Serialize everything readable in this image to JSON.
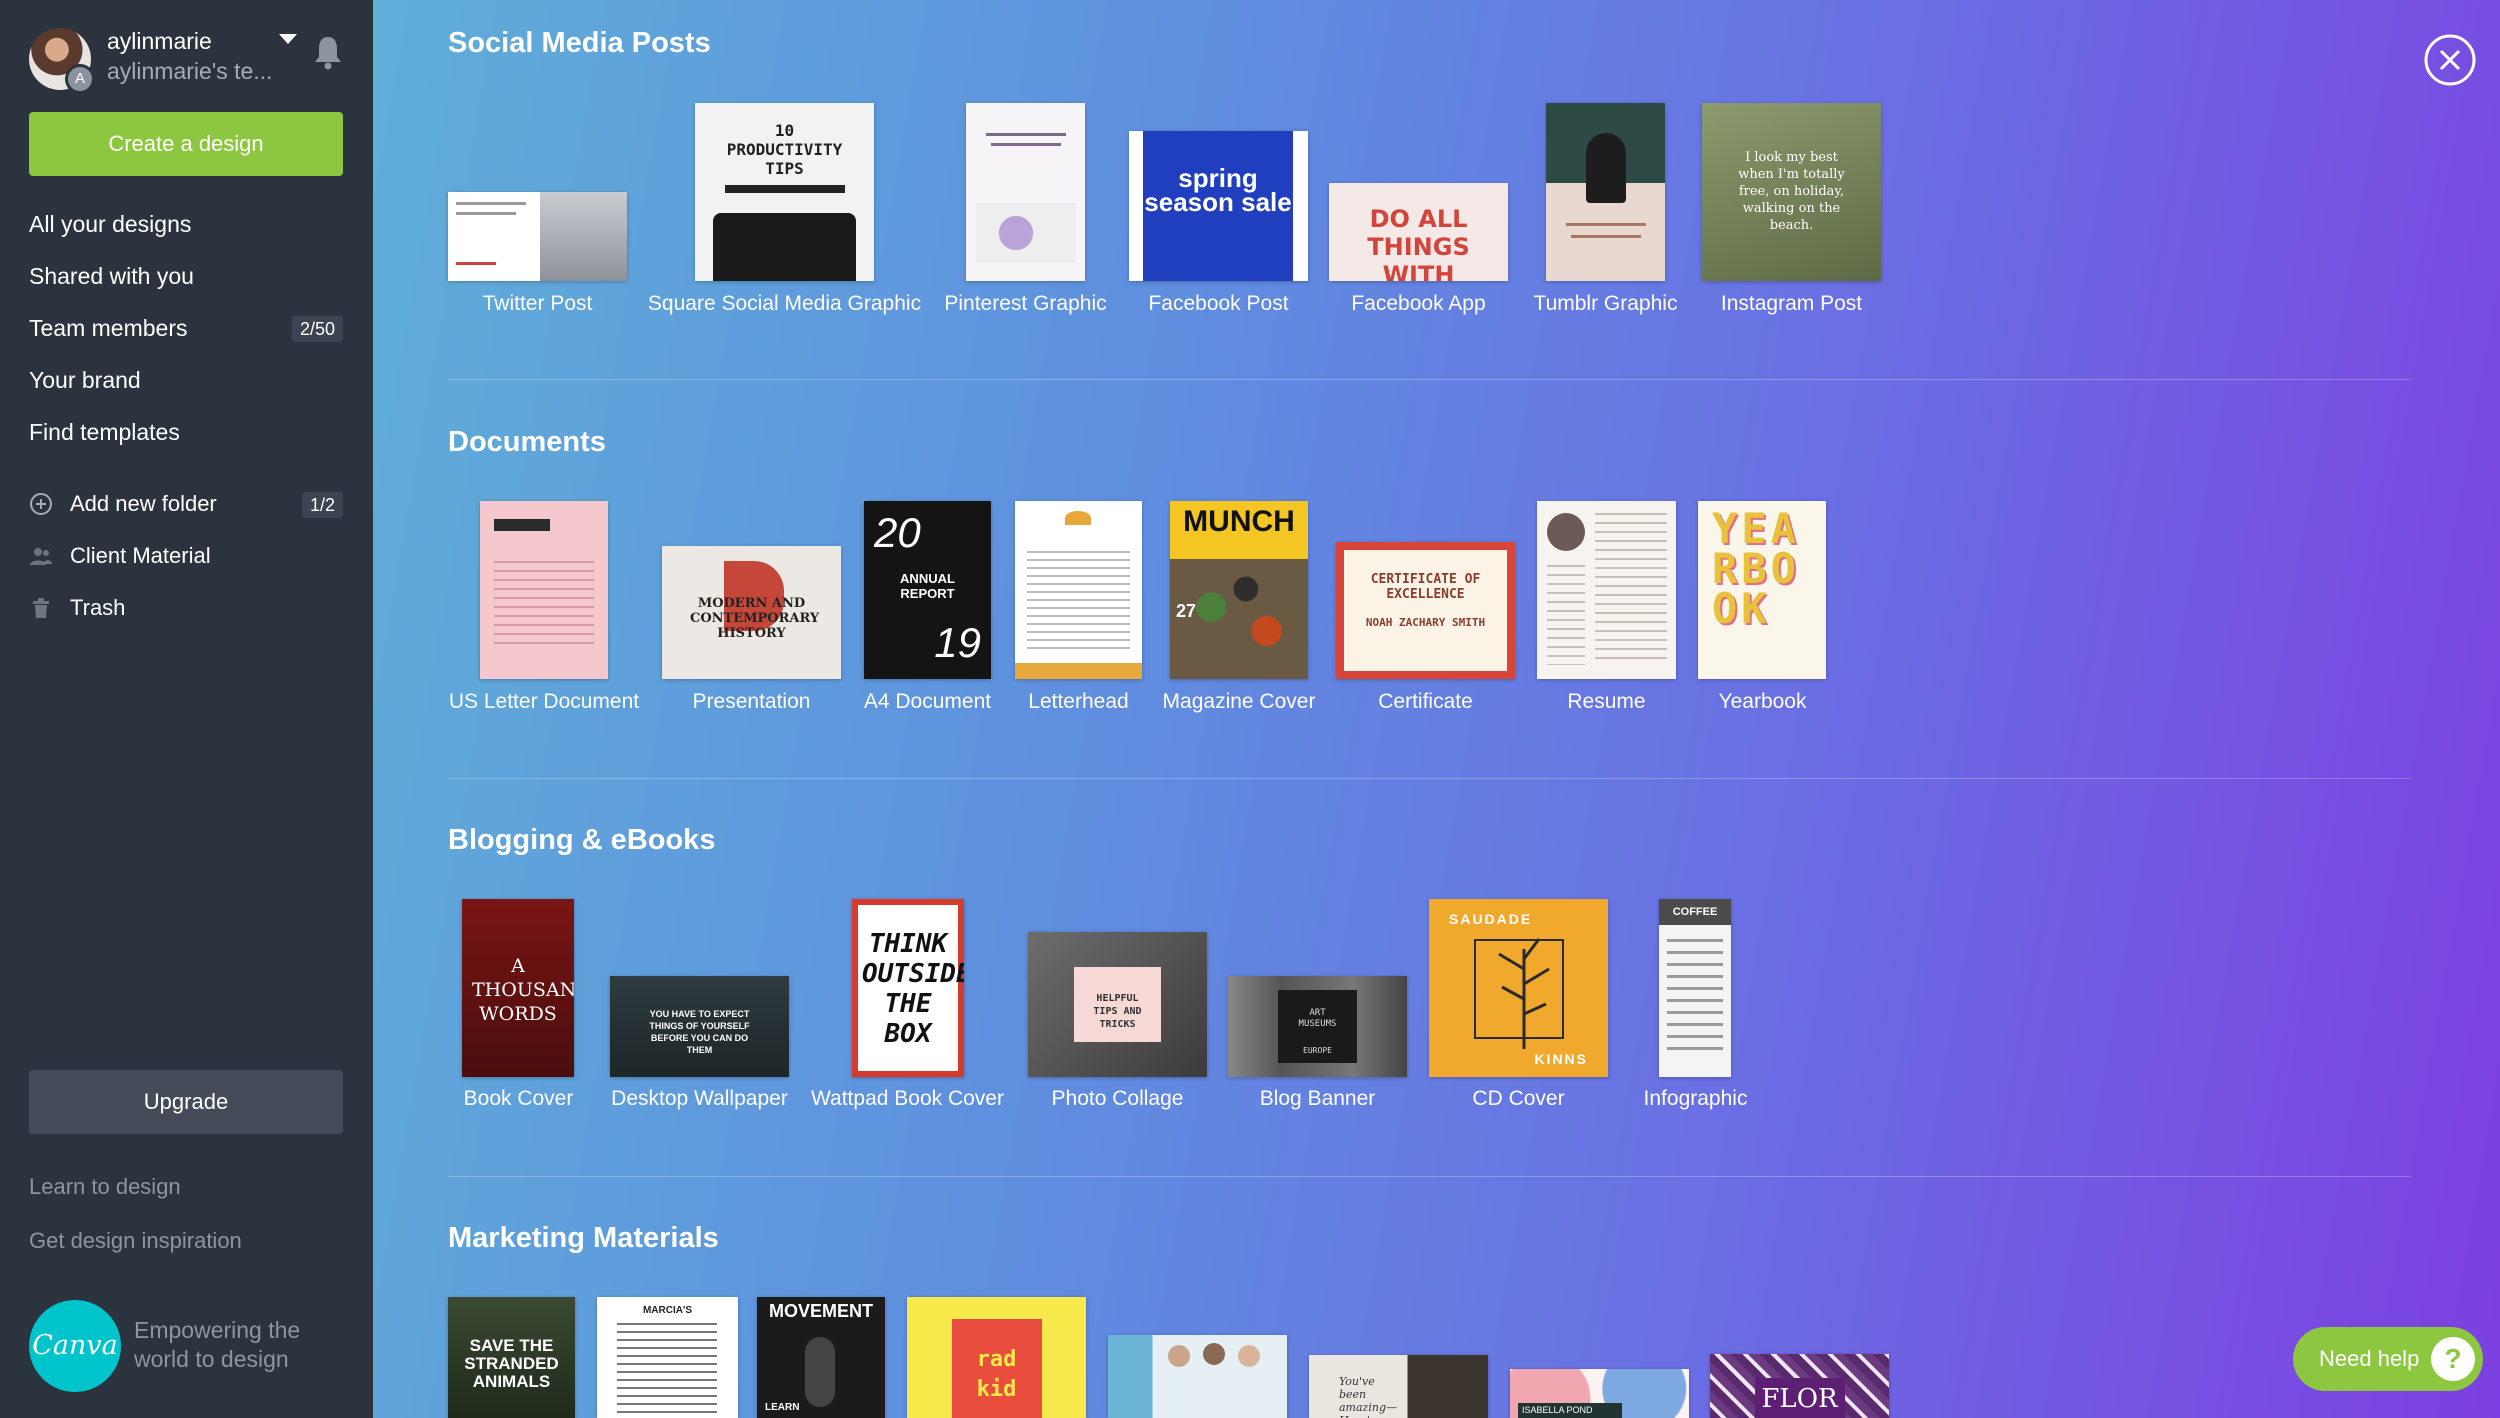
{
  "sidebar": {
    "user": {
      "name": "aylinmarie",
      "team": "aylinmarie's te...",
      "avatar_badge": "A"
    },
    "create_label": "Create a design",
    "nav": [
      {
        "label": "All your designs"
      },
      {
        "label": "Shared with you"
      },
      {
        "label": "Team members",
        "count": "2/50"
      },
      {
        "label": "Your brand"
      },
      {
        "label": "Find templates"
      }
    ],
    "folders": [
      {
        "label": "Add new folder",
        "count": "1/2",
        "icon": "plus-circle-icon"
      },
      {
        "label": "Client Material",
        "icon": "people-icon"
      },
      {
        "label": "Trash",
        "icon": "trash-icon"
      }
    ],
    "upgrade_label": "Upgrade",
    "learn_label": "Learn to design",
    "inspiration_label": "Get design inspiration",
    "logo_text": "Canva",
    "tagline": "Empowering the world to design"
  },
  "sections": {
    "social": {
      "title": "Social Media Posts",
      "items": [
        "Twitter Post",
        "Square Social Media Graphic",
        "Pinterest Graphic",
        "Facebook Post",
        "Facebook App",
        "Tumblr Graphic",
        "Instagram Post"
      ]
    },
    "documents": {
      "title": "Documents",
      "items": [
        "US Letter Document",
        "Presentation",
        "A4 Document",
        "Letterhead",
        "Magazine Cover",
        "Certificate",
        "Resume",
        "Yearbook"
      ]
    },
    "blogging": {
      "title": "Blogging & eBooks",
      "items": [
        "Book Cover",
        "Desktop Wallpaper",
        "Wattpad Book Cover",
        "Photo Collage",
        "Blog Banner",
        "CD Cover",
        "Infographic"
      ]
    },
    "marketing": {
      "title": "Marketing Materials"
    }
  },
  "thumb_text": {
    "productivity": "10 PRODUCTIVITY TIPS",
    "spring": "spring season sale",
    "fbapp": "DO ALL THINGS WITH LOVE",
    "instagram": "I look my best when I'm totally free, on holiday, walking on the beach.",
    "presentation": "MODERN AND CONTEMPORARY HISTORY",
    "annual_top": "20",
    "annual_mid": "ANNUAL REPORT",
    "annual_bottom": "19",
    "munch": "MUNCH",
    "munch_issue": "27",
    "certificate": "CERTIFICATE OF EXCELLENCE",
    "cert_name": "NOAH ZACHARY SMITH",
    "yearbook": "YEARBOOK",
    "book_cover": "A THOUSAND WORDS",
    "wallpaper": "YOU HAVE TO EXPECT THINGS OF YOURSELF BEFORE YOU CAN DO THEM",
    "wattpad": "THINK OUTSIDE THE BOX",
    "collage": "HELPFUL TIPS AND TRICKS",
    "blog_banner": "ART MUSEUMS",
    "blog_banner_sub": "EUROPE",
    "cd_top": "SAUDADE",
    "cd_bottom": "KINNS",
    "infographic": "COFFEE",
    "animals": "SAVE THE STRANDED ANIMALS",
    "menu": "MARCIA'S",
    "movement": "MOVEMENT",
    "movement_sub": "LEARN",
    "radkid": "rad kid",
    "isabella": "ISABELLA POND",
    "flor": "FLOR",
    "quote": "You've been amazing—Here's a"
  },
  "colors": {
    "sidebar_bg": "#2b333e",
    "accent_green": "#8dc63f",
    "canva_teal": "#00c4cc"
  },
  "help": {
    "label": "Need help",
    "icon": "?"
  }
}
